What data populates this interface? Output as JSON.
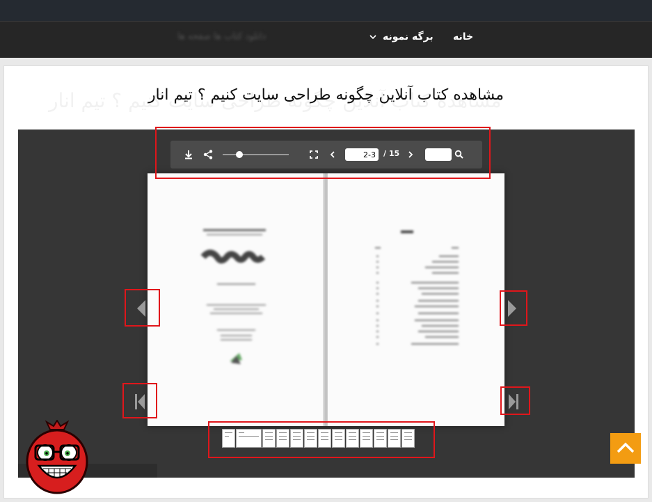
{
  "nav": {
    "home": "خانه",
    "sample_page": "برگه نمونه",
    "blurred_links": "دانلود      کتاب ها      صفحه ها"
  },
  "page": {
    "title": "مشاهده کتاب آنلاین چگونه طراحی سایت کنیم ؟ تیم انار",
    "ghost_title": "مشاهده کتاب آنلاین چگونه طراحی سایت کنیم ؟ تیم انار"
  },
  "viewer": {
    "page_input_value": "2-3",
    "total_pages": "/ 15",
    "zoom_level": 0.25,
    "icons": {
      "download": "download-icon",
      "share": "share-icon",
      "fullscreen": "fullscreen-icon",
      "prev": "chevron-left-icon",
      "next": "chevron-right-icon",
      "search": "search-icon"
    },
    "thumbnail_count": 11
  },
  "colors": {
    "topbar": "#252a31",
    "navbar": "#262626",
    "viewer_bg": "#363636",
    "toolbar_bg": "#4b4b4b",
    "highlight": "#e0161b",
    "scroll_top": "#f39c12"
  }
}
